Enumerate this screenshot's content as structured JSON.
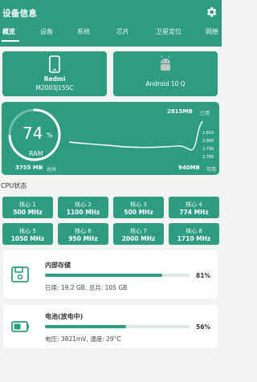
{
  "app": {
    "title": "设备信息"
  },
  "tabs": [
    "概览",
    "设备",
    "系统",
    "芯片",
    "卫星定位",
    "网络"
  ],
  "device": {
    "brand": "Redmi",
    "model": "M2003J15SC",
    "os": "Android 10 Q"
  },
  "ram": {
    "percent": "74",
    "percent_sign": "%",
    "label": "RAM",
    "total": "3755 MB",
    "total_label": "总共",
    "used": "2815MB",
    "used_label": "已用",
    "free": "940MB",
    "free_label": "可用",
    "ticks": [
      "2,810",
      "2,800",
      "2,790",
      "2,780"
    ],
    "percent_value": 0.74
  },
  "cpu": {
    "title": "CPU状态",
    "cores": [
      {
        "name": "核心 1",
        "freq": "500 MHz"
      },
      {
        "name": "核心 2",
        "freq": "1100 MHz"
      },
      {
        "name": "核心 3",
        "freq": "500 MHz"
      },
      {
        "name": "核心 4",
        "freq": "774 MHz"
      },
      {
        "name": "核心 5",
        "freq": "1050 MHz"
      },
      {
        "name": "核心 6",
        "freq": "950 MHz"
      },
      {
        "name": "核心 7",
        "freq": "2000 MHz"
      },
      {
        "name": "核心 8",
        "freq": "1710 MHz"
      }
    ]
  },
  "storage": {
    "title": "内部存储",
    "percent": "81%",
    "percent_value": 0.81,
    "detail": "已用: 19.2 GB, 总共: 105 GB"
  },
  "battery": {
    "title": "电池(放电中)",
    "percent": "56%",
    "percent_value": 0.56,
    "detail": "电压: 3821mV, 温度: 29°C"
  },
  "colors": {
    "accent": "#2e9c80",
    "bar_track": "#d6ece5"
  },
  "icons": [
    "gear-icon",
    "phone-icon",
    "android-icon",
    "storage-icon",
    "battery-icon"
  ]
}
